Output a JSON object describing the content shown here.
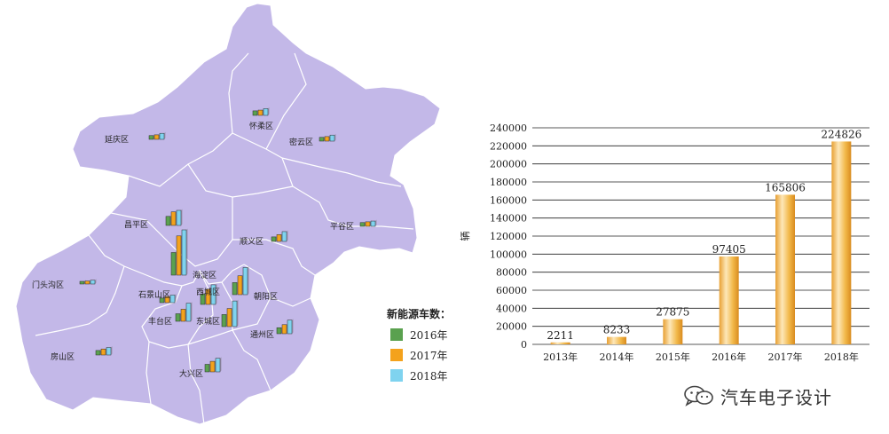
{
  "colors": {
    "map_fill": "#c3b8e8",
    "map_border": "#ffffff",
    "y2016": "#5aa14f",
    "y2017": "#f4a21c",
    "y2018": "#7fd3ef",
    "bar_gold": "#f2b94a",
    "grid": "#222222"
  },
  "map": {
    "legend": {
      "title": "新能源车数：",
      "items": [
        {
          "label": "2016年",
          "color_key": "y2016"
        },
        {
          "label": "2017年",
          "color_key": "y2017"
        },
        {
          "label": "2018年",
          "color_key": "y2018"
        }
      ]
    },
    "districts": [
      {
        "name": "延庆区",
        "v2016": 0.5,
        "v2017": 0.6,
        "v2018": 0.8
      },
      {
        "name": "怀柔区",
        "v2016": 0.6,
        "v2017": 0.7,
        "v2018": 0.9
      },
      {
        "name": "密云区",
        "v2016": 0.5,
        "v2017": 0.6,
        "v2018": 0.8
      },
      {
        "name": "昌平区",
        "v2016": 1.2,
        "v2017": 1.8,
        "v2018": 2.0
      },
      {
        "name": "平谷区",
        "v2016": 0.5,
        "v2017": 0.6,
        "v2018": 0.7
      },
      {
        "name": "顺义区",
        "v2016": 0.6,
        "v2017": 0.9,
        "v2018": 1.3
      },
      {
        "name": "海淀区",
        "v2016": 3.0,
        "v2017": 5.2,
        "v2018": 6.0
      },
      {
        "name": "门头沟区",
        "v2016": 0.3,
        "v2017": 0.4,
        "v2018": 0.5
      },
      {
        "name": "石景山区",
        "v2016": 0.6,
        "v2017": 0.8,
        "v2018": 1.0
      },
      {
        "name": "西城区",
        "v2016": 1.4,
        "v2017": 2.0,
        "v2018": 2.6
      },
      {
        "name": "朝阳区",
        "v2016": 1.6,
        "v2017": 2.5,
        "v2018": 3.6
      },
      {
        "name": "丰台区",
        "v2016": 1.0,
        "v2017": 1.6,
        "v2018": 2.4
      },
      {
        "name": "东城区",
        "v2016": 1.6,
        "v2017": 2.4,
        "v2018": 3.4
      },
      {
        "name": "通州区",
        "v2016": 0.8,
        "v2017": 1.2,
        "v2018": 1.8
      },
      {
        "name": "房山区",
        "v2016": 0.6,
        "v2017": 0.8,
        "v2018": 1.0
      },
      {
        "name": "大兴区",
        "v2016": 1.0,
        "v2017": 1.4,
        "v2018": 1.8
      }
    ]
  },
  "chart_data": {
    "type": "bar",
    "title": "",
    "xlabel": "",
    "ylabel": "辆",
    "categories": [
      "2013年",
      "2014年",
      "2015年",
      "2016年",
      "2017年",
      "2018年"
    ],
    "values": [
      2211,
      8233,
      27875,
      97405,
      165806,
      224826
    ],
    "data_labels": [
      "2211",
      "8233",
      "27875",
      "97405",
      "165806",
      "224826"
    ],
    "ylim": [
      0,
      240000
    ],
    "yticks": [
      "0",
      "20000",
      "40000",
      "60000",
      "80000",
      "100000",
      "120000",
      "140000",
      "160000",
      "180000",
      "200000",
      "220000",
      "240000"
    ],
    "grid": true,
    "legend": "none"
  },
  "watermark": {
    "text": "汽车电子设计",
    "icon": "wechat-icon"
  }
}
